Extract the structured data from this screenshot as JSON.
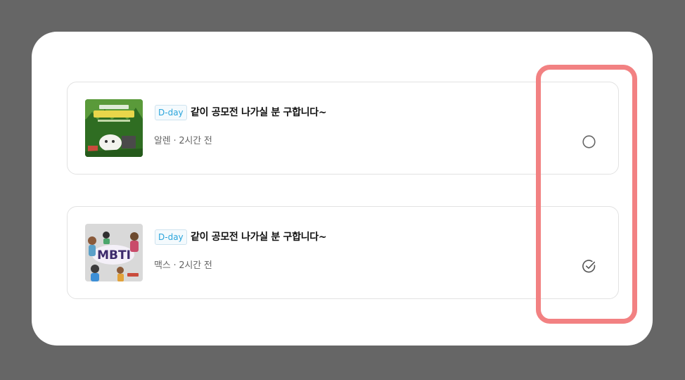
{
  "posts": [
    {
      "badge": "D-day",
      "title": "같이 공모전 나가실 분 구합니다~",
      "meta": "알렌 · 2시간 전",
      "thumbnail_icon": "contest-poster-thumbnail",
      "checked": false,
      "check_icon": "radio-unchecked-icon"
    },
    {
      "badge": "D-day",
      "title": "같이 공모전 나가실 분 구합니다~",
      "meta": "맥스 · 2시간 전",
      "thumbnail_icon": "mbti-poster-thumbnail",
      "thumbnail_text": "MBTI",
      "checked": true,
      "check_icon": "check-circle-icon"
    }
  ],
  "colors": {
    "backdrop": "#666666",
    "badge_text": "#2aa5dc",
    "highlight": "#f28182"
  }
}
